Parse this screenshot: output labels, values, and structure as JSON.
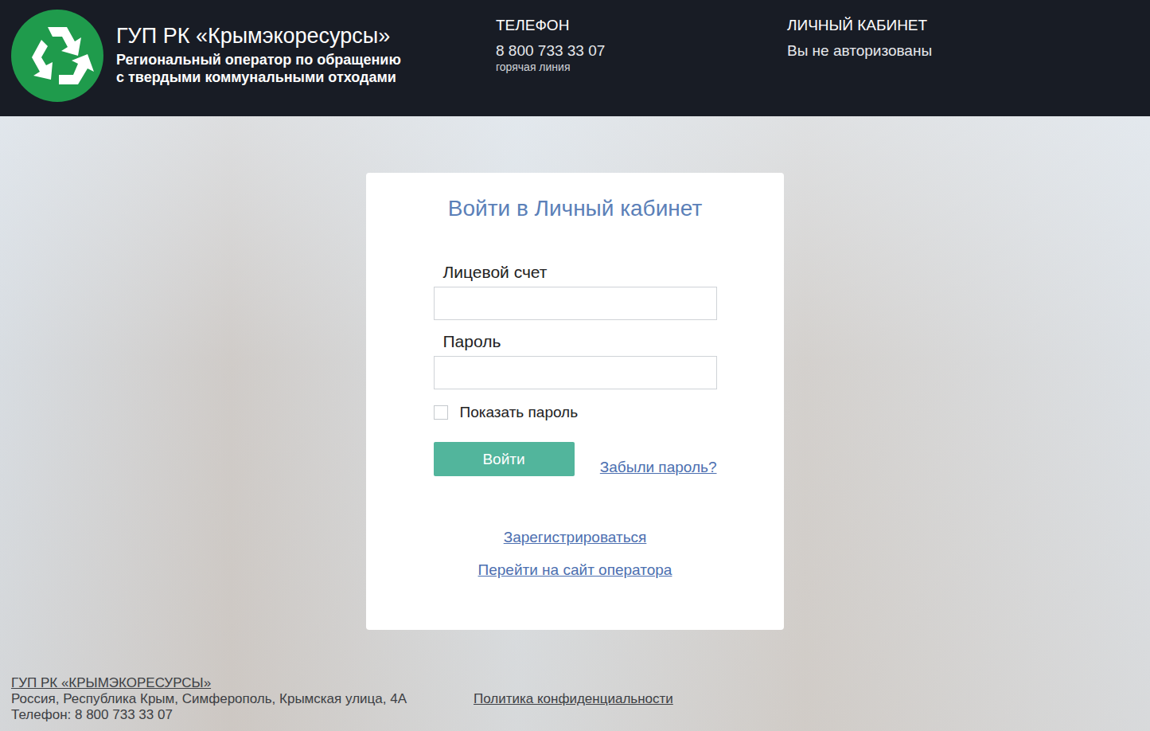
{
  "header": {
    "title": "ГУП РК «Крымэкоресурсы»",
    "subtitle": [
      "Региональный оператор по обращению",
      "с твердыми коммунальными отходами"
    ],
    "phone": {
      "heading": "ТЕЛЕФОН",
      "number": "8 800 733 33 07",
      "note": "горячая линия"
    },
    "account": {
      "heading": "ЛИЧНЫЙ КАБИНЕТ",
      "status": "Вы не авторизованы"
    }
  },
  "login": {
    "title": "Войти в Личный кабинет",
    "fields": [
      {
        "label": "Лицевой счет",
        "value": "",
        "kind": "text"
      },
      {
        "label": "Пароль",
        "value": "",
        "kind": "password"
      }
    ],
    "show_password": {
      "label": "Показать пароль",
      "checked": false
    },
    "submit": "Войти",
    "forgot": "Забыли пароль?",
    "links": [
      "Зарегистрироваться",
      "Перейти на сайт оператора"
    ]
  },
  "footer": {
    "company": "ГУП РК «КРЫМЭКОРЕСУРСЫ»",
    "address": "Россия, Республика Крым, Симферополь, Крымская улица, 4А",
    "phone": "Телефон: 8 800 733 33 07",
    "privacy": "Политика конфиденциальности"
  }
}
